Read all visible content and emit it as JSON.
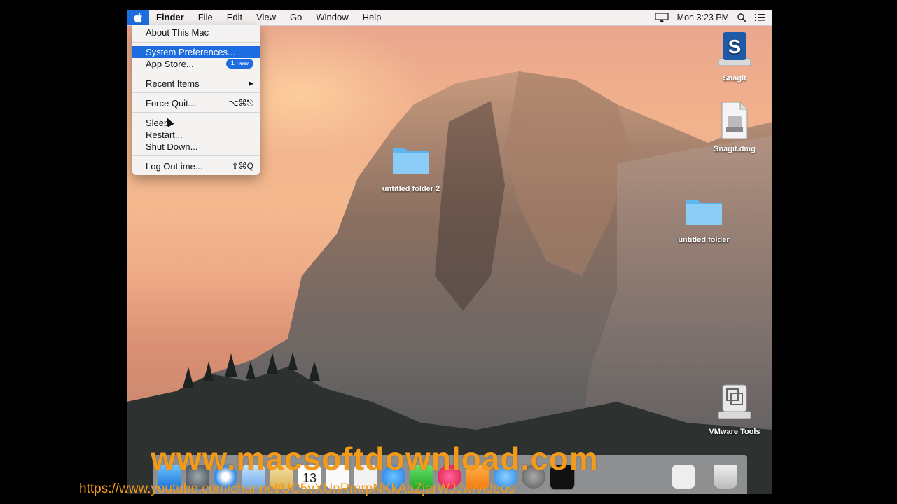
{
  "menubar": {
    "apple_icon": "apple-icon",
    "items": [
      "Finder",
      "File",
      "Edit",
      "View",
      "Go",
      "Window",
      "Help"
    ],
    "clock": "Mon 3:23 PM",
    "right_icons": [
      "airplay-icon",
      "spotlight-icon",
      "notification-center-icon"
    ]
  },
  "apple_menu": {
    "about": "About This Mac",
    "system_prefs": "System Preferences...",
    "app_store": "App Store...",
    "app_store_badge": "1 new",
    "recent_items": "Recent Items",
    "recent_items_arrow": "▶",
    "force_quit": "Force Quit...",
    "force_quit_shortcut": "⌥⌘⎋",
    "sleep": "Sleep",
    "restart": "Restart...",
    "shut_down": "Shut Down...",
    "log_out": "Log Out ime...",
    "log_out_shortcut": "⇧⌘Q"
  },
  "desktop_icons": {
    "snagit": "Snagit",
    "snagit_dmg": "Snagit.dmg",
    "folder2": "untitled folder 2",
    "folder1": "untitled folder",
    "vmware": "VMware Tools"
  },
  "dock": {
    "items": [
      "finder-icon",
      "launchpad-icon",
      "safari-icon",
      "mail-icon",
      "notes-icon",
      "calendar-icon",
      "reminders-icon",
      "photos-icon",
      "messages-icon",
      "facetime-icon",
      "itunes-icon",
      "ibooks-icon",
      "app-store-icon",
      "system-preferences-icon",
      "activity-monitor-icon",
      "documents-folder-icon",
      "trash-icon"
    ],
    "calendar_date": "13"
  },
  "watermark": {
    "site": "www.macsoftdownload.com",
    "url": "https://www.youtube.com/channel/UC5vXUnRmrpNKkAaZjarWJJw/videos"
  }
}
